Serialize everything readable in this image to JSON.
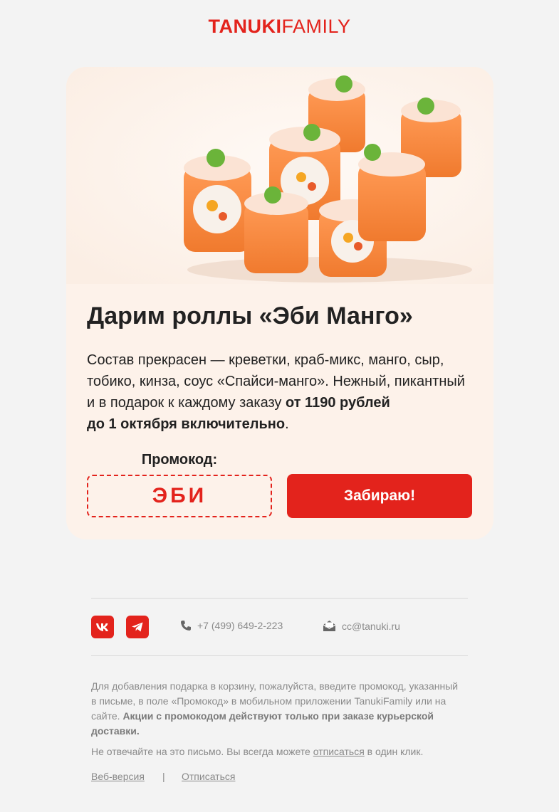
{
  "logo": {
    "part1": "TANUKI",
    "part2": "FAMILY"
  },
  "promo_card": {
    "title": "Дарим роллы «Эби Манго»",
    "desc_text": "Состав прекрасен — креветки, краб-микс, манго, сыр, тобико, кинза, соус «Спайси-манго». Нежный, пикантный и в подарок к каждому заказу ",
    "desc_bold_1": "от 1190 рублей",
    "desc_bold_2": "до 1 октября включительно",
    "desc_end": ".",
    "promo_label": "Промокод:",
    "promo_code": "ЭБИ",
    "cta_label": "Забираю!"
  },
  "footer": {
    "social": [
      {
        "name": "vk-icon"
      },
      {
        "name": "telegram-icon"
      }
    ],
    "phone": "+7 (499) 649-2-223",
    "email": "cc@tanuki.ru",
    "note_text": "Для добавления подарка в корзину, пожалуйста, введите промокод, указанный в письме, в поле «Промокод» в мобильном приложении TanukiFamily или на сайте. ",
    "note_bold": "Акции с промокодом действуют только при заказе курьерской доставки.",
    "unsub_text_1": "Не отвечайте на это письмо. Вы всегда можете ",
    "unsub_link": "отписаться",
    "unsub_text_2": " в один клик.",
    "web_version": "Веб-версия",
    "separator": "|",
    "unsubscribe": "Отписаться"
  },
  "colors": {
    "brand_red": "#e3231c",
    "card_bg": "#fdf2ea",
    "page_bg": "#f3f3f3"
  }
}
